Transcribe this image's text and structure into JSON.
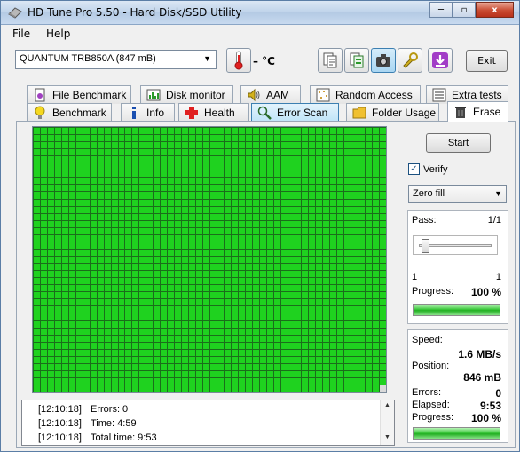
{
  "window": {
    "title": "HD Tune Pro 5.50 - Hard Disk/SSD Utility",
    "minimize": "─",
    "maximize": "▫",
    "close": "x"
  },
  "menu": {
    "file": "File",
    "help": "Help"
  },
  "toolbar": {
    "device": "QUANTUM TRB850A (847 mB)",
    "temperature": "– °C",
    "exit_label": "Exit",
    "icons": [
      "copy-text-icon",
      "copy-info-icon",
      "screenshot-camera-icon",
      "options-wrench-icon",
      "save-download-icon"
    ]
  },
  "tabs_top": [
    {
      "label": "File Benchmark",
      "icon": "file-benchmark-icon"
    },
    {
      "label": "Disk monitor",
      "icon": "disk-monitor-icon"
    },
    {
      "label": "AAM",
      "icon": "speaker-icon"
    },
    {
      "label": "Random Access",
      "icon": "random-access-icon"
    },
    {
      "label": "Extra tests",
      "icon": "extra-tests-icon"
    }
  ],
  "tabs_bottom": [
    {
      "label": "Benchmark",
      "icon": "benchmark-bulb-icon"
    },
    {
      "label": "Info",
      "icon": "info-icon"
    },
    {
      "label": "Health",
      "icon": "health-cross-icon"
    },
    {
      "label": "Error Scan",
      "icon": "error-scan-magnifier-icon"
    },
    {
      "label": "Folder Usage",
      "icon": "folder-icon"
    },
    {
      "label": "Erase",
      "icon": "erase-trash-icon"
    }
  ],
  "grid": {
    "columns": 50,
    "rows": 37,
    "ok_color": "#1fd21f",
    "line_color": "#1b6e1b",
    "unscanned_blocks": 1
  },
  "log": [
    {
      "time": "[12:10:18]",
      "text": "Errors: 0"
    },
    {
      "time": "[12:10:18]",
      "text": "Time: 4:59"
    },
    {
      "time": "[12:10:18]",
      "text": "Total time: 9:53"
    }
  ],
  "controls": {
    "start_label": "Start",
    "verify_label": "Verify",
    "verify_checked": true,
    "fill_mode": "Zero fill"
  },
  "pass_box": {
    "pass_label": "Pass:",
    "pass_value": "1/1",
    "slider_min": "1",
    "slider_max": "1",
    "progress_label": "Progress:",
    "progress_value": "100 %",
    "progress_fraction": 1.0
  },
  "stats_box": {
    "speed_label": "Speed:",
    "speed_value": "1.6 MB/s",
    "position_label": "Position:",
    "position_value": "846 mB",
    "errors_label": "Errors:",
    "errors_value": "0",
    "elapsed_label": "Elapsed:",
    "elapsed_value": "9:53",
    "progress_label": "Progress:",
    "progress_value": "100 %",
    "progress_fraction": 1.0
  },
  "colors": {
    "accent": "#3c7fb1",
    "progress_green": "#3cc83c"
  }
}
